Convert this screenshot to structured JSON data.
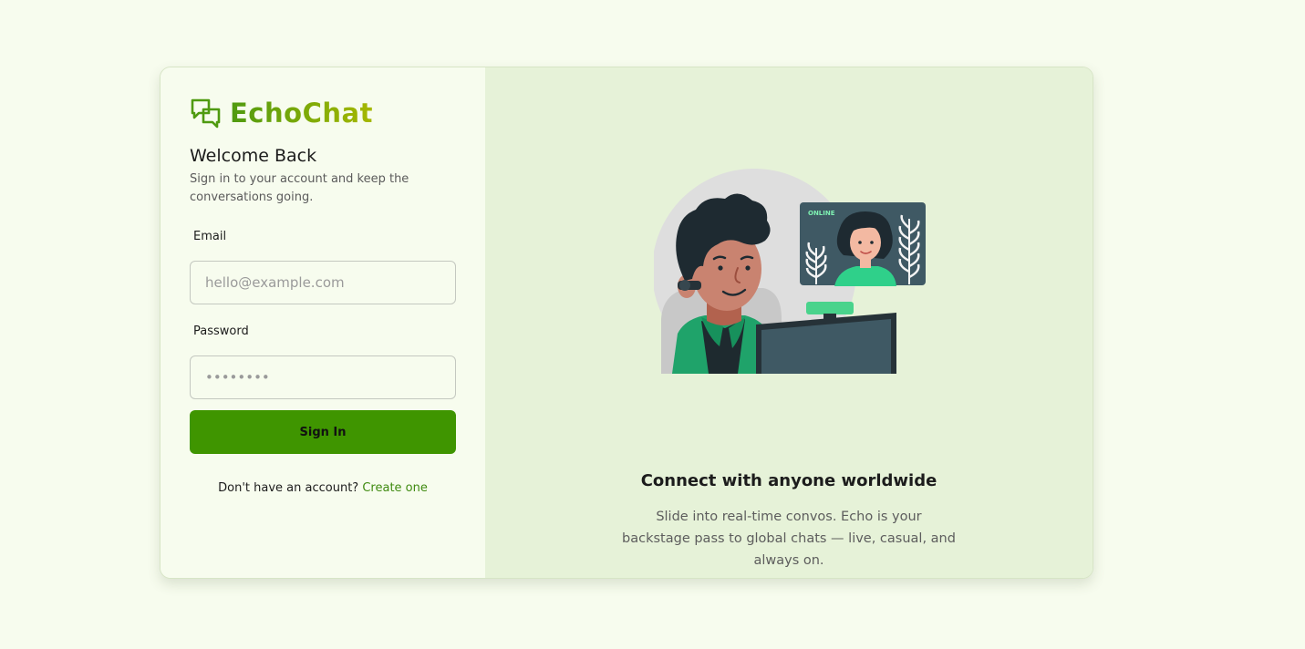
{
  "brand": {
    "name": "EchoChat",
    "logo_icon": "chat-bubbles-icon"
  },
  "login": {
    "title": "Welcome Back",
    "subtitle": "Sign in to your account and keep the conversations going.",
    "email_label": "Email",
    "email_placeholder": "hello@example.com",
    "password_label": "Password",
    "password_placeholder": "••••••••",
    "submit_label": "Sign In",
    "signup_prompt": "Don't have an account?",
    "signup_link": "Create one"
  },
  "promo": {
    "badge": "ONLINE",
    "title": "Connect with anyone worldwide",
    "text": "Slide into real-time convos. Echo is your backstage pass to global chats — live, casual, and always on."
  },
  "colors": {
    "background": "#f7fcee",
    "panel": "#e6f2d8",
    "accent": "#3f9500",
    "link": "#3f8a10"
  }
}
